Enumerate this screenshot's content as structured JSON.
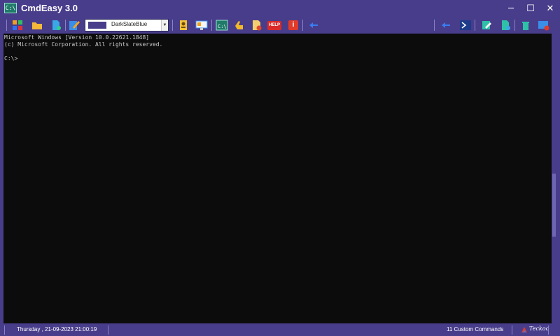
{
  "app": {
    "icon_text": "C:\\",
    "title": "CmdEasy 3.0"
  },
  "window_controls": {
    "minimize": "─",
    "maximize": "☐",
    "close": "✕"
  },
  "toolbar": {
    "color_select_value": "DarkSlateBlue",
    "color_select_swatch": "#483d8b",
    "help_text": "HELP",
    "info_text": "i",
    "cmd_icon_text": "C:\\"
  },
  "console": {
    "lines": [
      "Microsoft Windows [Version 10.0.22621.1848]",
      "(c) Microsoft Corporation. All rights reserved.",
      "",
      "C:\\>"
    ]
  },
  "statusbar": {
    "datetime": "Thursday , 21-09-2023 21:00:19",
    "custom_commands": "11 Custom Commands",
    "brand": "Teckoo"
  },
  "colors": {
    "chrome": "#483d8b",
    "console_bg": "#0c0c0c",
    "console_text": "#cccccc"
  }
}
